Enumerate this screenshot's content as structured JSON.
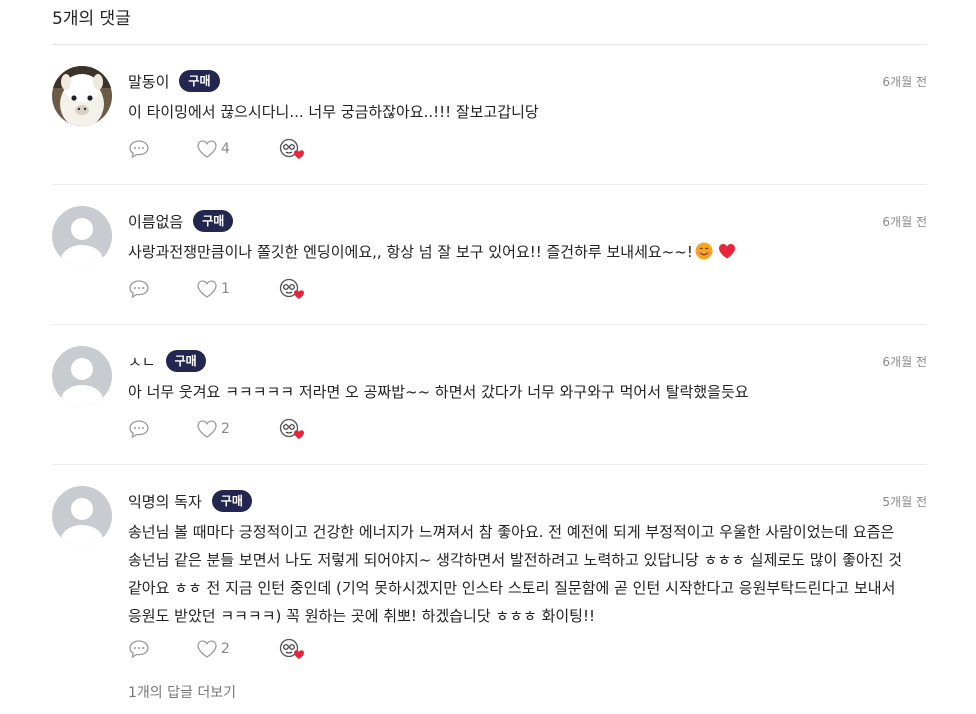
{
  "header": {
    "comment_count_label": "5개의 댓글"
  },
  "comments": [
    {
      "author": "말동이",
      "badge": "구매",
      "time": "6개월 전",
      "text": "이 타이밍에서 끊으시다니... 너무 궁금하잖아요..!!! 잘보고갑니당",
      "likes": "4",
      "avatar": "alpaca-photo"
    },
    {
      "author": "이름없음",
      "badge": "구매",
      "time": "6개월 전",
      "text": "사랑과전쟁만큼이나 쫄깃한 엔딩이에요,, 항상 넘 잘 보구 있어요!! 즐건하루 보내세요~~!",
      "emoji": [
        "smiling-face-emoji",
        "red-heart-emoji"
      ],
      "likes": "1",
      "avatar": "default-avatar"
    },
    {
      "author": "ㅅㄴ",
      "badge": "구매",
      "time": "6개월 전",
      "text": "아 너무 웃겨요 ㅋㅋㅋㅋㅋ 저라면 오 공짜밥~~ 하면서 갔다가 너무 와구와구 먹어서 탈락했을듯요",
      "likes": "2",
      "avatar": "default-avatar"
    },
    {
      "author": "익명의 독자",
      "badge": "구매",
      "time": "5개월 전",
      "text": "송넌님 볼 때마다 긍정적이고 건강한 에너지가 느껴져서 참 좋아요. 전 예전에 되게 부정적이고 우울한 사람이었는데 요즘은 송넌님 같은 분들 보면서 나도 저렇게 되어야지~ 생각하면서 발전하려고 노력하고 있답니당 ㅎㅎㅎ 실제로도 많이 좋아진 것 같아요 ㅎㅎ 전 지금 인턴 중인데 (기억 못하시겠지만 인스타 스토리 질문함에 곧 인턴 시작한다고 응원부탁드린다고 보내서 응원도 받았던 ㅋㅋㅋㅋ) 꼭 원하는 곳에 취뽀! 하겠습니닷 ㅎㅎㅎ 화이팅!!",
      "likes": "2",
      "avatar": "default-avatar"
    }
  ],
  "footer": {
    "more_replies_label": "1개의 답글 더보기"
  },
  "colors": {
    "badge_bg": "#23264f",
    "heart_red": "#e8253a",
    "muted": "#8a8a8a"
  }
}
